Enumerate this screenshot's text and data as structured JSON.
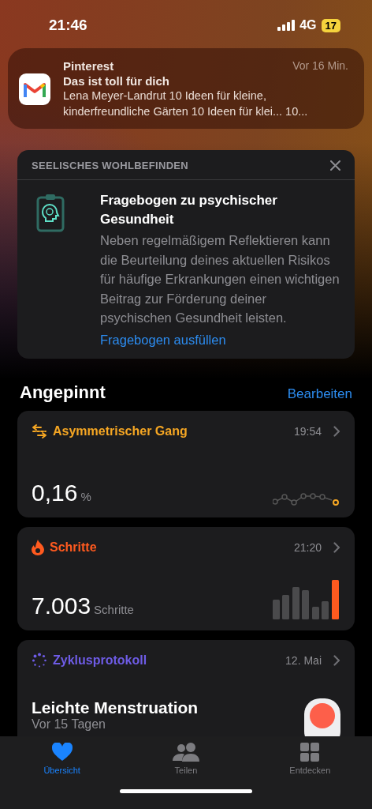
{
  "status_bar": {
    "time": "21:46",
    "network": "4G",
    "battery": "17"
  },
  "notification": {
    "app": "Pinterest",
    "time": "Vor 16 Min.",
    "title": "Das ist toll für dich",
    "body": "Lena Meyer-Landrut 10 Ideen für kleine, kinderfreundliche Gärten 10 Ideen für klei... 10..."
  },
  "suggestion": {
    "category": "SEELISCHES WOHLBEFINDEN",
    "title": "Fragebogen zu psychischer Gesundheit",
    "body": "Neben regelmäßigem Reflektieren kann die Beurteilung deines aktuellen Risikos für häufige Erkrankungen einen wichtigen Beitrag zur Förderung deiner psychischen Gesundheit leisten.",
    "link": "Fragebogen ausfüllen"
  },
  "pinned": {
    "title": "Angepinnt",
    "edit": "Bearbeiten",
    "cards": [
      {
        "kind": "gait",
        "title": "Asymmetrischer Gang",
        "time": "19:54",
        "value": "0,16",
        "unit": "%",
        "color": "#f5a623"
      },
      {
        "kind": "steps",
        "title": "Schritte",
        "time": "21:20",
        "value": "7.003",
        "unit": "Schritte",
        "color": "#ff5a1f"
      },
      {
        "kind": "cycle",
        "title": "Zyklusprotokoll",
        "time": "12. Mai",
        "value": "Leichte Menstruation",
        "subtitle": "Vor 15 Tagen",
        "color": "#6e5ce6"
      }
    ]
  },
  "tab_bar": [
    {
      "kind": "heart",
      "label": "Übersicht",
      "selected": true
    },
    {
      "kind": "people",
      "label": "Teilen",
      "selected": false
    },
    {
      "kind": "grid",
      "label": "Entdecken",
      "selected": false
    }
  ]
}
